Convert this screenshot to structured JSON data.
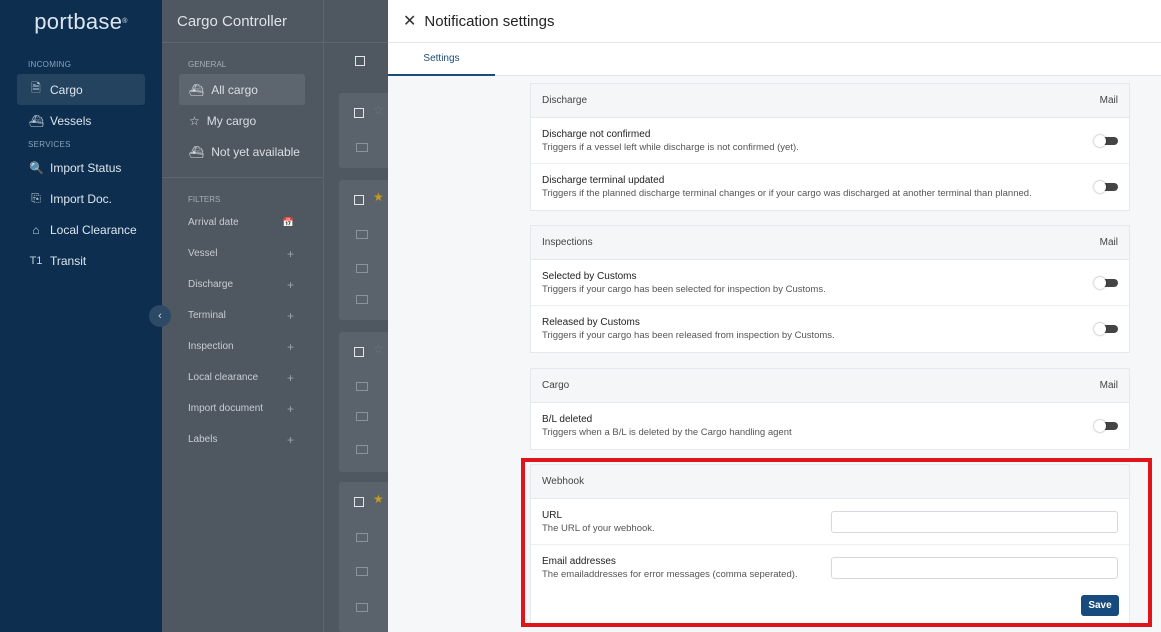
{
  "app": {
    "logo": "portbase",
    "title": "Cargo Controller"
  },
  "nav": {
    "incoming_label": "INCOMING",
    "incoming": [
      {
        "label": "Cargo",
        "icon": "document-icon",
        "glyph": "🗎"
      },
      {
        "label": "Vessels",
        "icon": "vessel-icon",
        "glyph": "⛴"
      }
    ],
    "services_label": "SERVICES",
    "services": [
      {
        "label": "Import Status",
        "icon": "search-icon",
        "glyph": "🔍"
      },
      {
        "label": "Import Doc.",
        "icon": "file-import-icon",
        "glyph": "⎘"
      },
      {
        "label": "Local Clearance",
        "icon": "warehouse-icon",
        "glyph": "⌂"
      },
      {
        "label": "Transit",
        "icon": "t1-icon",
        "glyph": "T1"
      }
    ]
  },
  "filters": {
    "general_label": "GENERAL",
    "general": [
      {
        "label": "All cargo",
        "glyph": "⛴"
      },
      {
        "label": "My cargo",
        "glyph": "☆"
      },
      {
        "label": "Not yet available",
        "glyph": "⛴"
      }
    ],
    "filters_label": "FILTERS",
    "rows": [
      {
        "label": "Arrival date",
        "action": "📅"
      },
      {
        "label": "Vessel",
        "action": "+"
      },
      {
        "label": "Discharge",
        "action": "+"
      },
      {
        "label": "Terminal",
        "action": "+"
      },
      {
        "label": "Inspection",
        "action": "+"
      },
      {
        "label": "Local clearance",
        "action": "+"
      },
      {
        "label": "Import document",
        "action": "+"
      },
      {
        "label": "Labels",
        "action": "+"
      }
    ]
  },
  "modal": {
    "title": "Notification settings",
    "close_icon": "✕",
    "tab": "Settings",
    "sections": [
      {
        "title": "Discharge",
        "channel": "Mail",
        "items": [
          {
            "title": "Discharge not confirmed",
            "desc": "Triggers if a vessel left while discharge is not confirmed (yet)."
          },
          {
            "title": "Discharge terminal updated",
            "desc": "Triggers if the planned discharge terminal changes or if your cargo was discharged at another terminal than planned."
          }
        ]
      },
      {
        "title": "Inspections",
        "channel": "Mail",
        "items": [
          {
            "title": "Selected by Customs",
            "desc": "Triggers if your cargo has been selected for inspection by Customs."
          },
          {
            "title": "Released by Customs",
            "desc": "Triggers if your cargo has been released from inspection by Customs."
          }
        ]
      },
      {
        "title": "Cargo",
        "channel": "Mail",
        "items": [
          {
            "title": "B/L deleted",
            "desc": "Triggers when a B/L is deleted by the Cargo handling agent"
          }
        ]
      }
    ],
    "webhook": {
      "title": "Webhook",
      "url_title": "URL",
      "url_desc": "The URL of your webhook.",
      "url_value": "",
      "email_title": "Email addresses",
      "email_desc": "The emailaddresses for error messages (comma seperated).",
      "email_value": "",
      "save": "Save"
    }
  },
  "colors": {
    "nav_bg": "#0d2e4f",
    "accent": "#174a7d",
    "highlight": "#e0151b"
  }
}
